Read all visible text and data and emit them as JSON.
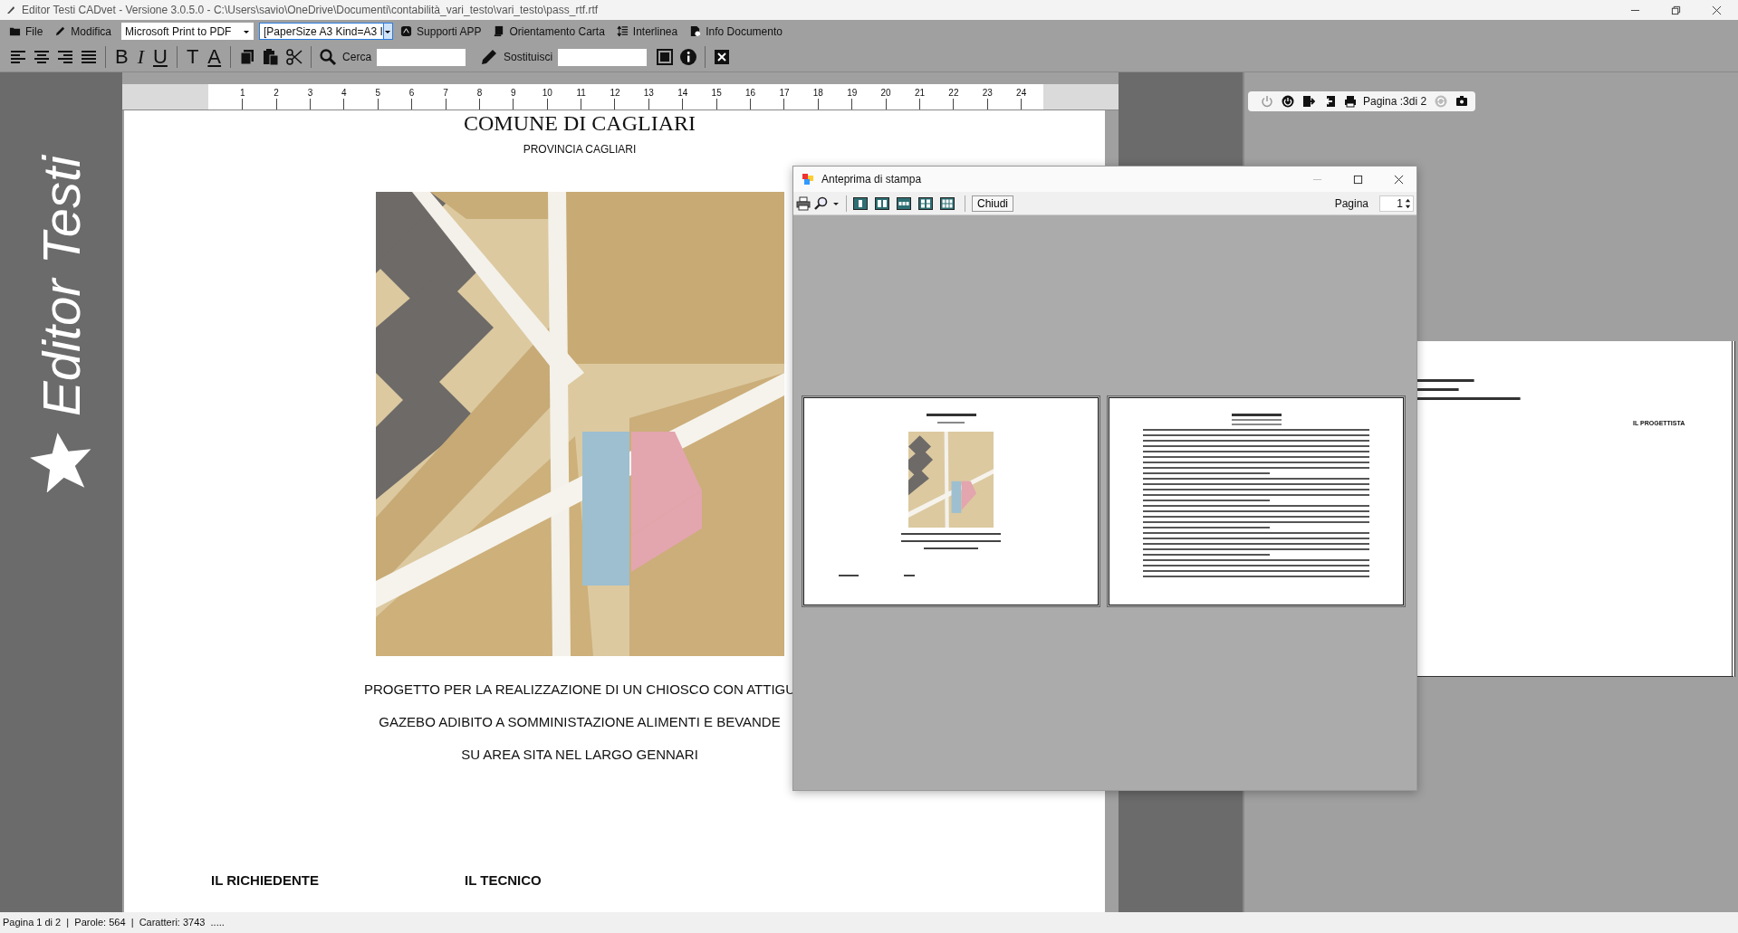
{
  "window": {
    "title": "Editor Testi CADvet - Versione 3.0.5.0 - C:\\Users\\savio\\OneDrive\\Documenti\\contabilità_vari_testo\\vari_testo\\pass_rtf.rtf"
  },
  "menu": [
    "File",
    "Modifica"
  ],
  "printer_select": {
    "value": "Microsoft Print to PDF"
  },
  "paper_select": {
    "value": "[PaperSize A3 Kind=A3 I",
    "focused": true
  },
  "menu_right": [
    "Supporti APP",
    "Orientamento Carta",
    "Interlinea",
    "Info Documento"
  ],
  "format_buttons": [
    "B",
    "I",
    "U",
    "T",
    "A"
  ],
  "search": {
    "label": "Cerca"
  },
  "replace": {
    "label": "Sostituisci"
  },
  "sidebar": {
    "title": "Editor Testi"
  },
  "ruler": {
    "numbers": [
      "1",
      "2",
      "3",
      "4",
      "5",
      "6",
      "7",
      "8",
      "9",
      "10",
      "11",
      "12",
      "13",
      "14",
      "15",
      "16",
      "17",
      "18",
      "19",
      "20",
      "21",
      "22",
      "23",
      "24"
    ]
  },
  "document": {
    "heading": "COMUNE DI CAGLIARI",
    "subheading": "PROVINCIA CAGLIARI",
    "picture": {
      "kind": "picture"
    },
    "title_lines": [
      "PROGETTO PER LA REALIZZAZIONE DI UN CHIOSCO CON ATTIGU",
      "GAZEBO ADIBITO A SOMMINISTAZIONE ALIMENTI E BEVANDE",
      "SU AREA SITA NEL LARGO GENNARI"
    ],
    "signatures": [
      "IL RICHIEDENTE",
      "IL TECNICO"
    ]
  },
  "page_toolbar": {
    "page_label": "Pagina :3di 2"
  },
  "side_page": {
    "signature": "IL PROGETTISTA"
  },
  "preview": {
    "title": "Anteprima di stampa",
    "close_button": "Chiudi",
    "page_label": "Pagina",
    "page_value": "1"
  },
  "status_bar": {
    "text": "Pagina 1 di 2  |  Parole: 564  |  Caratteri: 3743  ....."
  }
}
